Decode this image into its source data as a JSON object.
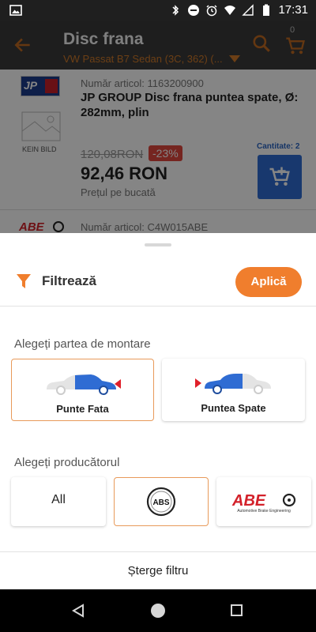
{
  "status_bar": {
    "time": "17:31"
  },
  "app_bar": {
    "title": "Disc frana",
    "subtitle": "VW Passat B7 Sedan (3C, 362) (...",
    "cart_count": "0"
  },
  "products": [
    {
      "logo_text": "JP",
      "no_image_text": "KEIN BILD",
      "article_number": "Număr articol: 1163200900",
      "title": "JP GROUP Disc frana puntea spate, Ø: 282mm, plin",
      "old_price": "120,08RON",
      "discount": "-23%",
      "price": "92,46 RON",
      "price_note": "Prețul pe bucată",
      "quantity_label": "Cantitate: 2"
    },
    {
      "article_number": "Număr articol: C4W015ABE"
    }
  ],
  "filter_sheet": {
    "title": "Filtrează",
    "apply_label": "Aplică",
    "mounting_label": "Alegeți partea de montare",
    "positions": [
      {
        "label": "Punte Fata",
        "selected": true
      },
      {
        "label": "Puntea Spate",
        "selected": false
      }
    ],
    "manufacturer_label": "Alegeți producătorul",
    "manufacturers": [
      {
        "label": "All",
        "selected": false
      },
      {
        "label": "ABS",
        "selected": true
      },
      {
        "label": "ABE",
        "tagline": "Automotive Brake Engineering",
        "selected": false
      }
    ],
    "clear_label": "Șterge filtru"
  },
  "colors": {
    "accent": "#f07e2d",
    "primary_blue": "#2f6cd3",
    "discount_red": "#e0473e"
  }
}
